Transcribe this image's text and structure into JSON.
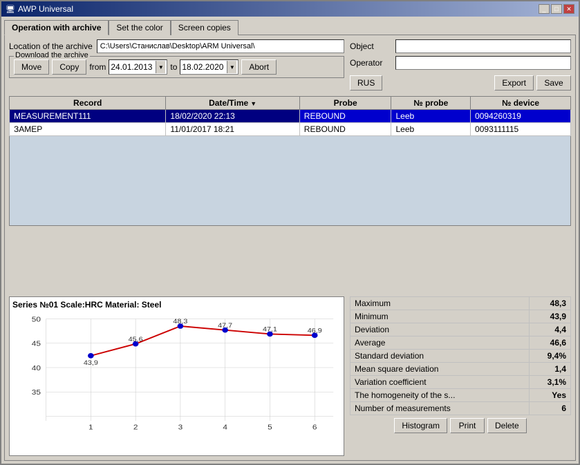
{
  "window": {
    "title": "AWP Universal"
  },
  "tabs": [
    {
      "label": "Operation with archive",
      "active": true
    },
    {
      "label": "Set the color",
      "active": false
    },
    {
      "label": "Screen copies",
      "active": false
    }
  ],
  "archive": {
    "label": "Location of the archive",
    "path": "C:\\Users\\Станислав\\Desktop\\ARM Universal\\",
    "download_label": "Download the archive"
  },
  "buttons": {
    "move": "Move",
    "copy": "Copy",
    "from_label": "from",
    "from_date": "24.01.2013",
    "to_label": "to",
    "to_date": "18.02.2020",
    "abort": "Abort",
    "rus": "RUS",
    "export": "Export",
    "save": "Save",
    "histogram": "Histogram",
    "print": "Print",
    "delete": "Delete"
  },
  "fields": {
    "object_label": "Object",
    "operator_label": "Operator"
  },
  "table": {
    "headers": [
      "Record",
      "Date/Time",
      "Probe",
      "№ probe",
      "№ device"
    ],
    "rows": [
      {
        "record": "MEASUREMENT111",
        "datetime": "18/02/2020 22:13",
        "probe": "REBOUND",
        "probe_num": "Leeb",
        "device_num": "0094260319",
        "selected": true
      },
      {
        "record": "ЗАМЕР",
        "datetime": "11/01/2017 18:21",
        "probe": "REBOUND",
        "probe_num": "Leeb",
        "device_num": "0093111115",
        "selected": false
      }
    ]
  },
  "chart": {
    "title": "Series №01 Scale:HRC Material: Steel",
    "points": [
      {
        "x": 1,
        "y": 43.9,
        "label": "43,9"
      },
      {
        "x": 2,
        "y": 45.6,
        "label": "45,6"
      },
      {
        "x": 3,
        "y": 48.3,
        "label": "48,3"
      },
      {
        "x": 4,
        "y": 47.7,
        "label": "47,7"
      },
      {
        "x": 5,
        "y": 47.1,
        "label": "47,1"
      },
      {
        "x": 6,
        "y": 46.9,
        "label": "46,9"
      }
    ],
    "y_min": 35,
    "y_max": 50,
    "y_labels": [
      "50",
      "45",
      "40",
      "35"
    ],
    "x_labels": [
      "1",
      "2",
      "3",
      "4",
      "5",
      "6"
    ]
  },
  "stats": [
    {
      "label": "Maximum",
      "value": "48,3"
    },
    {
      "label": "Minimum",
      "value": "43,9"
    },
    {
      "label": "Deviation",
      "value": "4,4"
    },
    {
      "label": "Average",
      "value": "46,6"
    },
    {
      "label": "Standard deviation",
      "value": "9,4%"
    },
    {
      "label": "Mean square deviation",
      "value": "1,4"
    },
    {
      "label": "Variation coefficient",
      "value": "3,1%"
    },
    {
      "label": "The homogeneity of the s...",
      "value": "Yes"
    },
    {
      "label": "Number of measurements",
      "value": "6"
    }
  ]
}
